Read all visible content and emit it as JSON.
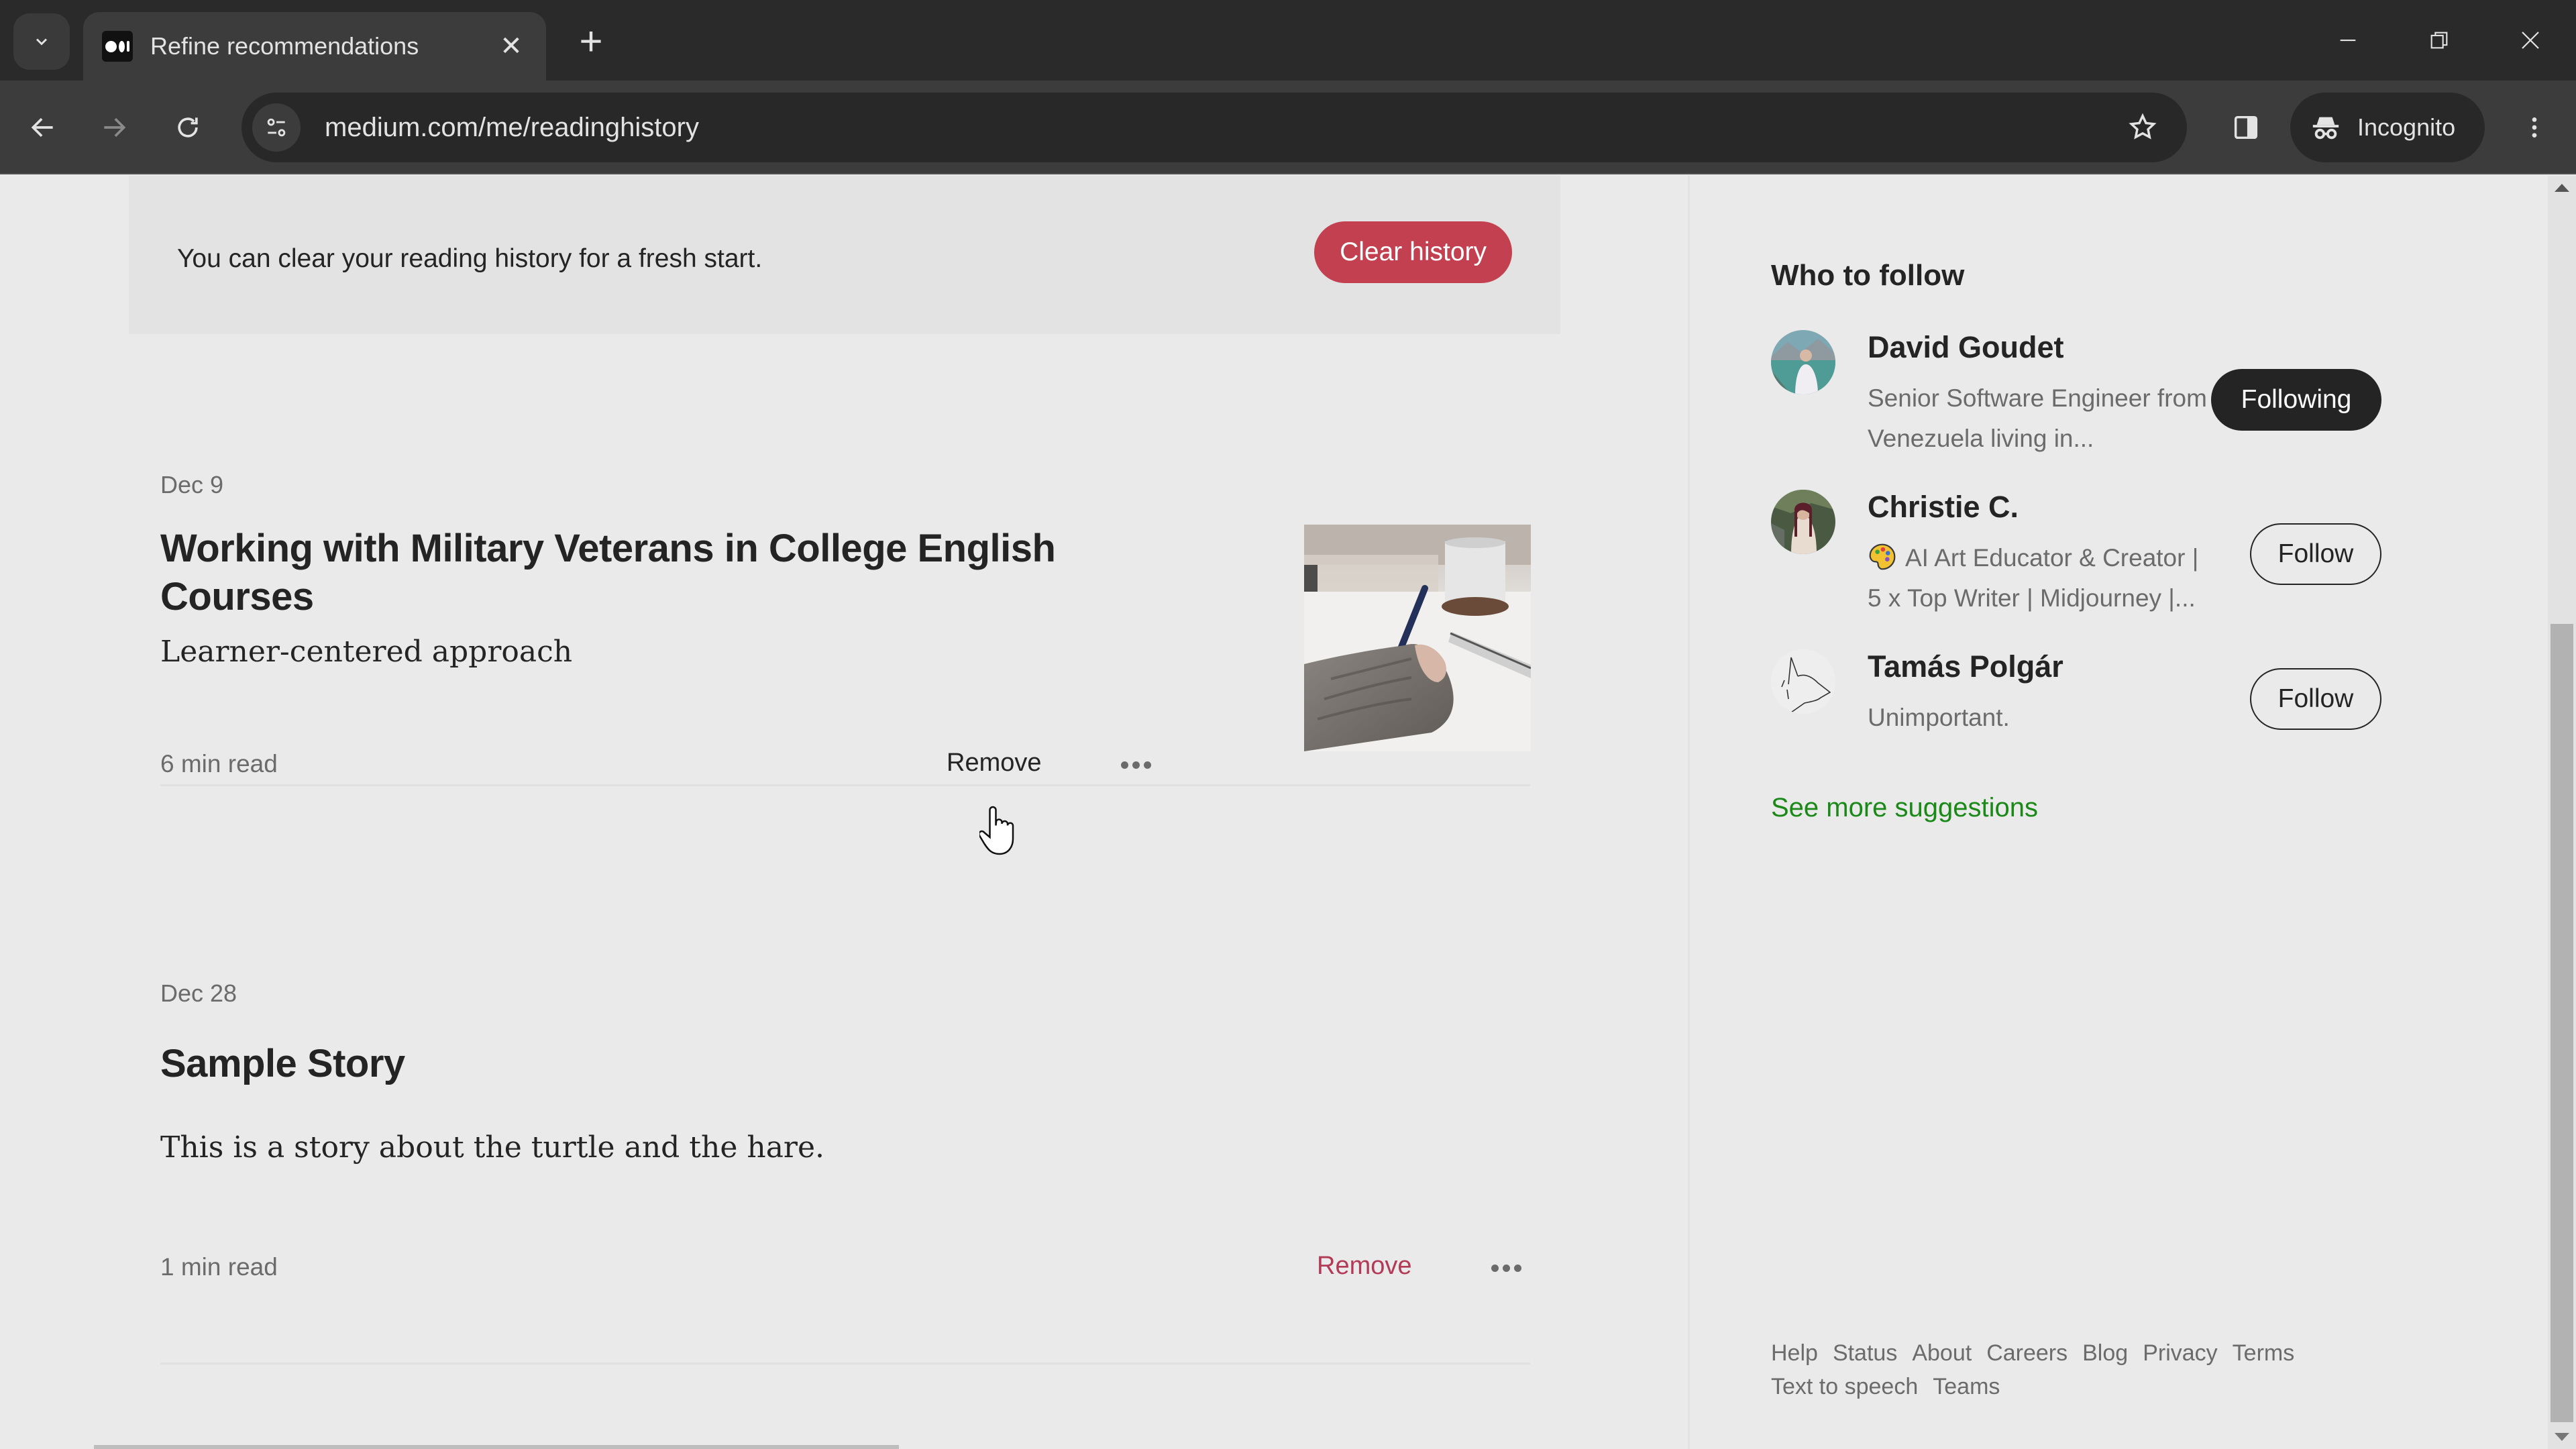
{
  "browser": {
    "tab": {
      "title": "Refine recommendations",
      "favicon": "medium-logo-icon"
    },
    "url": "medium.com/me/readinghistory",
    "profile_label": "Incognito",
    "icons": {
      "tab_search": "chevron-down-icon",
      "new_tab": "+",
      "close_tab": "✕",
      "back": "arrow-left-icon",
      "forward": "arrow-right-icon",
      "reload": "reload-icon",
      "site_info": "tune-icon",
      "bookmark": "star-icon",
      "side_panel": "side-panel-icon",
      "incognito": "incognito-icon",
      "menu": "kebab-menu-icon",
      "minimize": "minimize-icon",
      "restore": "restore-icon",
      "close_window": "close-icon"
    }
  },
  "banner": {
    "text": "You can clear your reading history for a fresh start.",
    "button_label": "Clear history",
    "accent_color": "#c2404f"
  },
  "articles": [
    {
      "date": "Dec 9",
      "title": "Working with Military Veterans in College English Courses",
      "subtitle": "Learner-centered approach",
      "read_time": "6 min read",
      "remove_label": "Remove",
      "has_thumbnail": true,
      "thumbnail_description": "hand writing with pen, coffee mug"
    },
    {
      "date": "Dec 28",
      "title": "Sample Story",
      "subtitle": "This is a story about the turtle and the hare.",
      "read_time": "1 min read",
      "remove_label": "Remove",
      "has_thumbnail": false
    }
  ],
  "sidebar": {
    "title": "Who to follow",
    "people": [
      {
        "name": "David Goudet",
        "bio": "Senior Software Engineer from Venezuela living in...",
        "button": "Following",
        "following": true
      },
      {
        "name": "Christie C.",
        "bio_emoji": "palette-icon",
        "bio": "AI Art Educator & Creator | 5 x Top Writer | Midjourney |...",
        "button": "Follow",
        "following": false
      },
      {
        "name": "Tamás Polgár",
        "bio": "Unimportant.",
        "button": "Follow",
        "following": false
      }
    ],
    "see_more": "See more suggestions",
    "link_color": "#1a8917",
    "footer_links": [
      "Help",
      "Status",
      "About",
      "Careers",
      "Blog",
      "Privacy",
      "Terms",
      "Text to speech",
      "Teams"
    ]
  }
}
